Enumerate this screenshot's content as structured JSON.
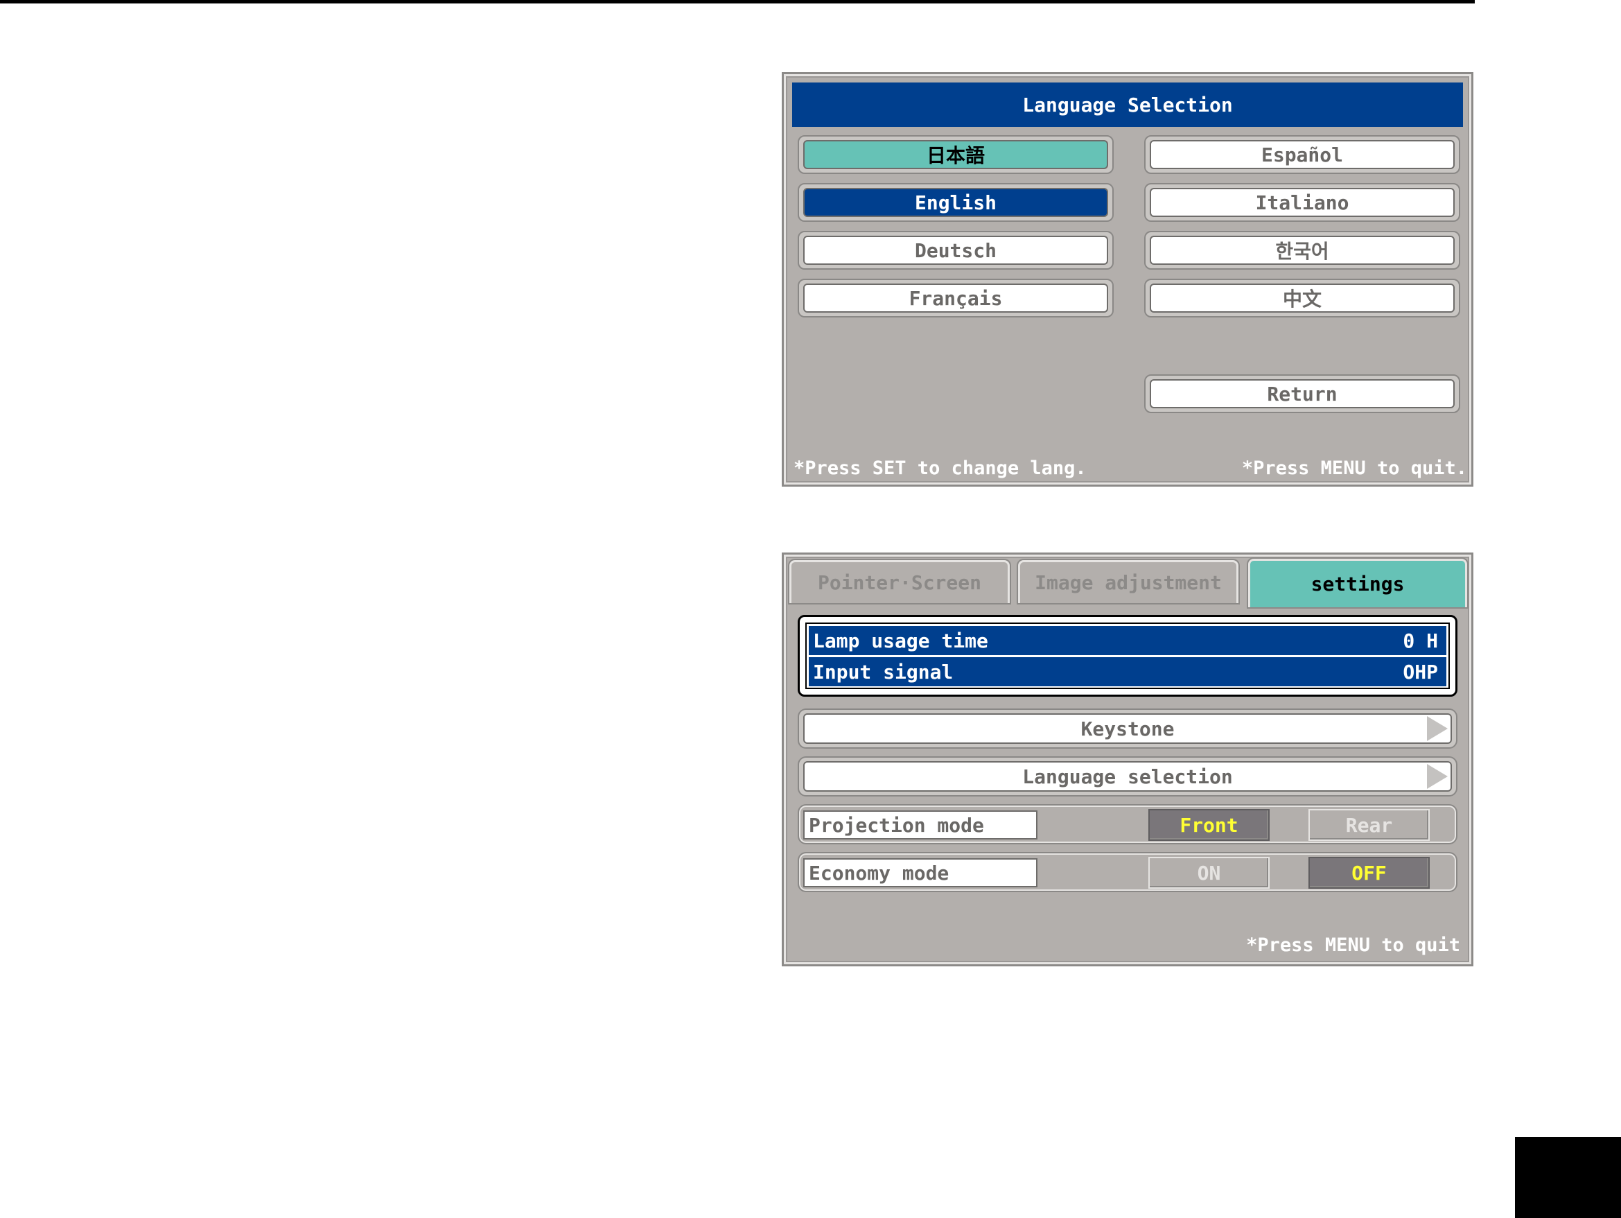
{
  "language_dialog": {
    "title": "Language Selection",
    "left_column": [
      {
        "label": "日本語",
        "state": "highlighted"
      },
      {
        "label": "English",
        "state": "selected"
      },
      {
        "label": "Deutsch",
        "state": "normal"
      },
      {
        "label": "Français",
        "state": "normal"
      }
    ],
    "right_column": [
      {
        "label": "Español",
        "state": "normal"
      },
      {
        "label": "Italiano",
        "state": "normal"
      },
      {
        "label": "한국어",
        "state": "normal"
      },
      {
        "label": "中文",
        "state": "normal"
      }
    ],
    "return_label": "Return",
    "footer_left": "*Press SET to change lang.",
    "footer_right": "*Press MENU to quit."
  },
  "settings_menu": {
    "tabs": [
      {
        "label": "Pointer·Screen",
        "active": false
      },
      {
        "label": "Image adjustment",
        "active": false
      },
      {
        "label": "settings",
        "active": true
      }
    ],
    "info": {
      "lamp_label": "Lamp usage time",
      "lamp_value": "0 H",
      "signal_label": "Input signal",
      "signal_value": "OHP"
    },
    "keystone_label": "Keystone",
    "language_label": "Language selection",
    "projection": {
      "label": "Projection mode",
      "options": [
        "Front",
        "Rear"
      ],
      "selected": "Front"
    },
    "economy": {
      "label": "Economy mode",
      "options": [
        "ON",
        "OFF"
      ],
      "selected": "OFF"
    },
    "footer": "*Press MENU to quit"
  },
  "colors": {
    "title_blue": "#003f8e",
    "teal_highlight": "#66c2b6",
    "panel_gray": "#b3afac",
    "option_active_text": "#ffff33"
  }
}
